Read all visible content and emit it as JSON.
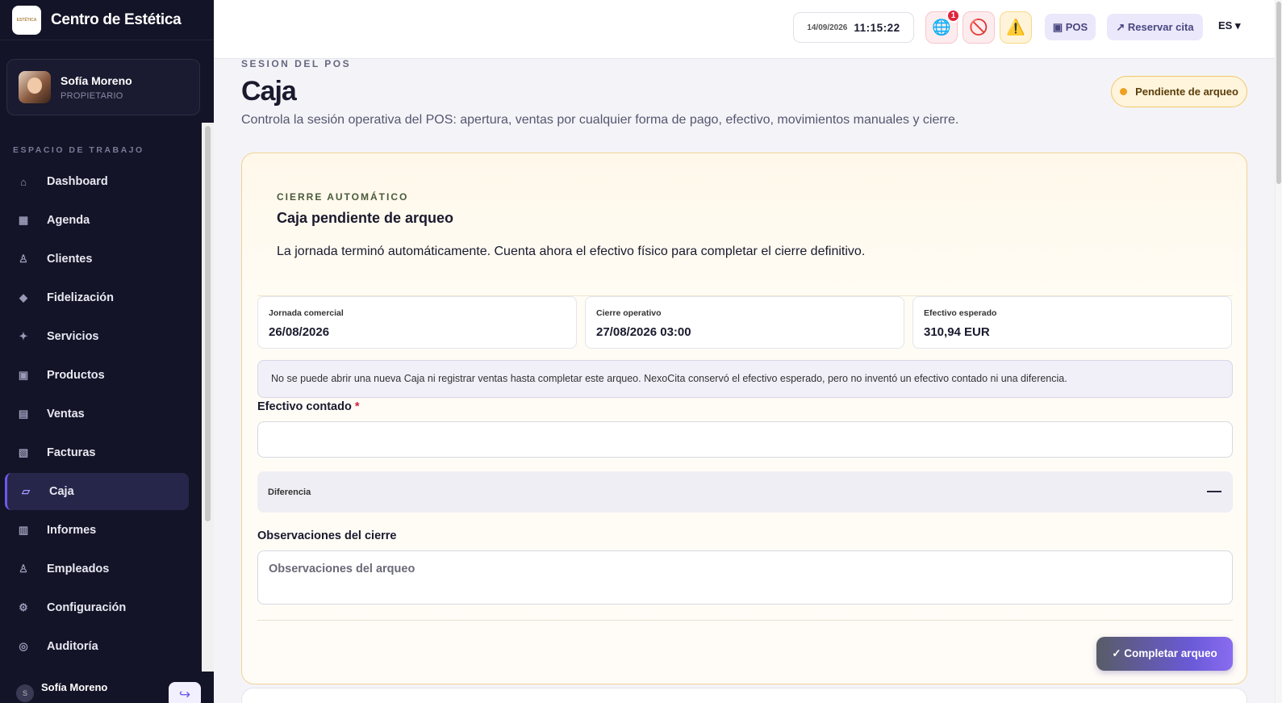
{
  "brand": {
    "logo_text": "ESTÉTICA",
    "name": "Centro de Estética"
  },
  "profile": {
    "name": "Sofía Moreno",
    "role": "PROPIETARIO"
  },
  "sidebar": {
    "section_label": "ESPACIO DE TRABAJO",
    "items": [
      {
        "label": "Dashboard",
        "icon": "⌂",
        "icon_name": "home-icon"
      },
      {
        "label": "Agenda",
        "icon": "▦",
        "icon_name": "calendar-icon"
      },
      {
        "label": "Clientes",
        "icon": "♙",
        "icon_name": "user-icon"
      },
      {
        "label": "Fidelización",
        "icon": "◆",
        "icon_name": "diamond-icon"
      },
      {
        "label": "Servicios",
        "icon": "✦",
        "icon_name": "sparkle-icon"
      },
      {
        "label": "Productos",
        "icon": "▣",
        "icon_name": "box-icon"
      },
      {
        "label": "Ventas",
        "icon": "▤",
        "icon_name": "list-icon"
      },
      {
        "label": "Facturas",
        "icon": "▧",
        "icon_name": "invoice-icon"
      },
      {
        "label": "Caja",
        "icon": "▱",
        "icon_name": "cash-register-icon",
        "active": true
      },
      {
        "label": "Informes",
        "icon": "▥",
        "icon_name": "report-icon"
      },
      {
        "label": "Empleados",
        "icon": "♙",
        "icon_name": "employees-icon"
      },
      {
        "label": "Configuración",
        "icon": "⚙",
        "icon_name": "gear-icon"
      },
      {
        "label": "Auditoría",
        "icon": "◎",
        "icon_name": "audit-icon"
      }
    ],
    "footer_user": {
      "initial": "S",
      "name": "Sofía Moreno"
    }
  },
  "topbar": {
    "date": "14/09/2026",
    "time": "11:15:22",
    "notification_count": "1",
    "globe_icon": "🌐",
    "block_icon": "🚫",
    "warning_icon": "⚠️",
    "pos_label": "▣ POS",
    "book_label": "↗ Reservar cita",
    "language": "ES ▾"
  },
  "page": {
    "eyebrow": "SESION DEL POS",
    "title": "Caja",
    "subtitle": "Controla la sesión operativa del POS: apertura, ventas por cualquier forma de pago, efectivo, movimientos manuales y cierre.",
    "status": "Pendiente de arqueo"
  },
  "closing_card": {
    "eyebrow": "CIERRE AUTOMÁTICO",
    "title": "Caja pendiente de arqueo",
    "description": "La jornada terminó automáticamente. Cuenta ahora el efectivo físico para completar el cierre definitivo.",
    "metrics": [
      {
        "label": "Jornada comercial",
        "value": "26/08/2026"
      },
      {
        "label": "Cierre operativo",
        "value": "27/08/2026 03:00"
      },
      {
        "label": "Efectivo esperado",
        "value": "310,94 EUR"
      }
    ],
    "notice": "No se puede abrir una nueva Caja ni registrar ventas hasta completar este arqueo. NexoCita conservó el efectivo esperado, pero no inventó un efectivo contado ni una diferencia.",
    "cash_label": "Efectivo contado",
    "required_mark": "*",
    "cash_value": "",
    "difference_label": "Diferencia",
    "difference_value": "—",
    "observations_label": "Observaciones del cierre",
    "observations_placeholder": "Observaciones del arqueo",
    "submit_label": "✓ Completar arqueo"
  }
}
